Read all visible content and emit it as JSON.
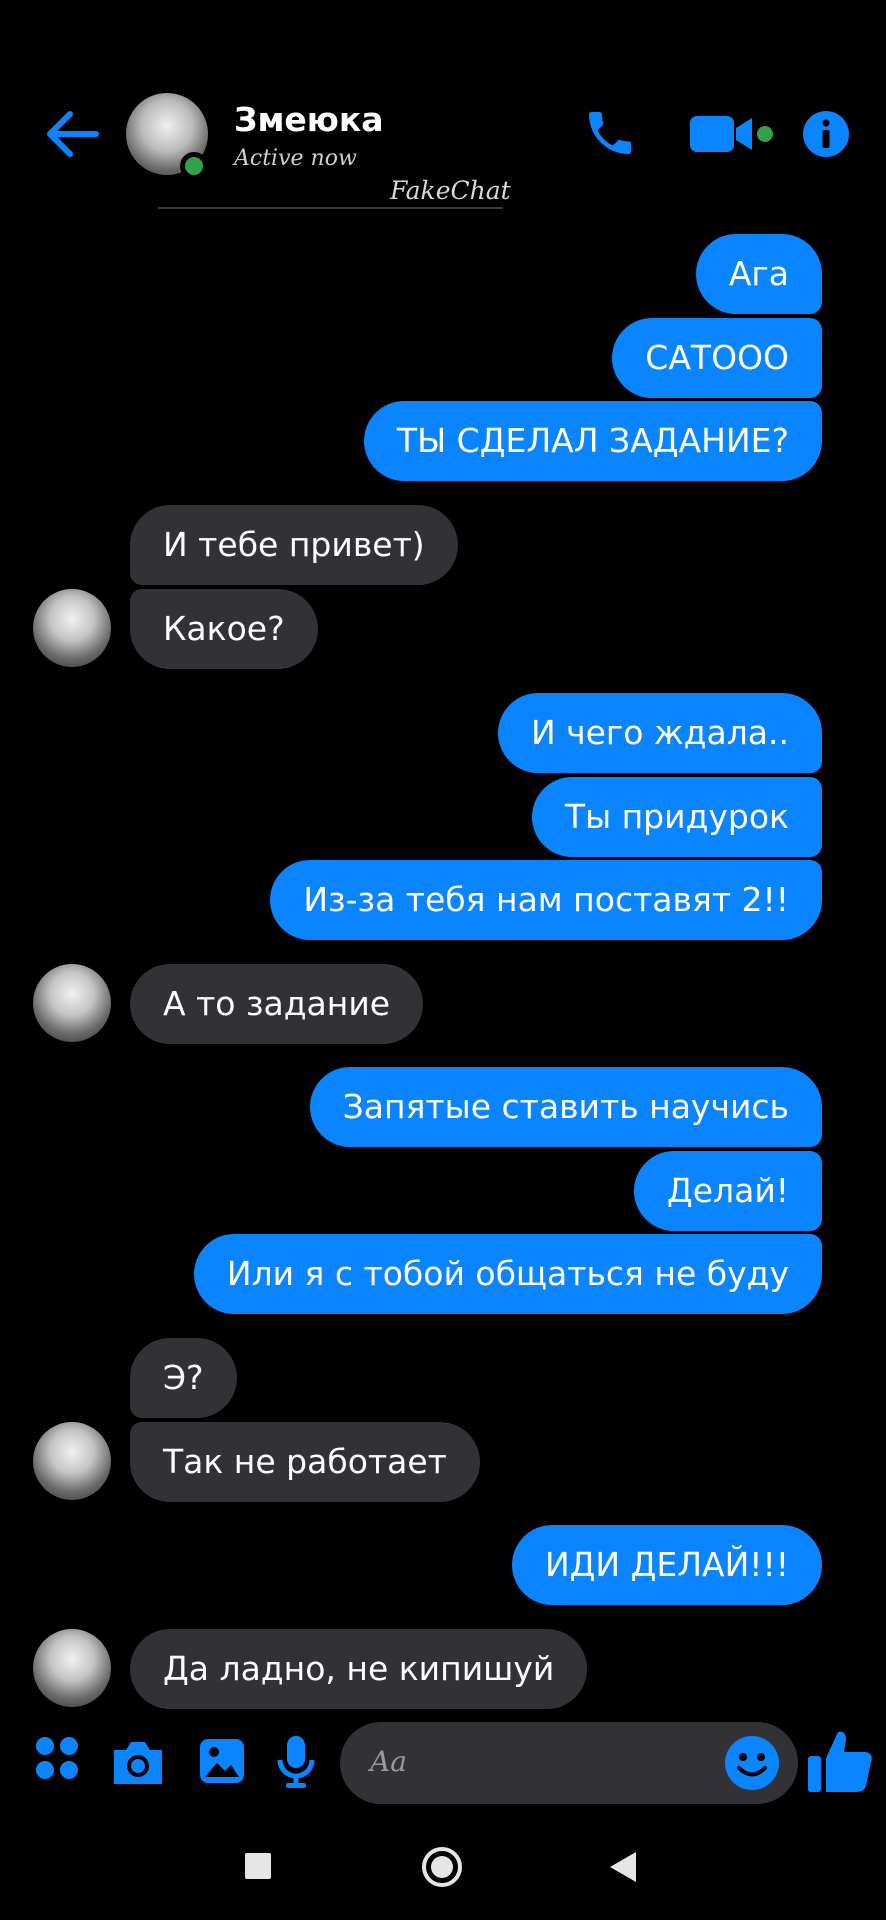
{
  "header": {
    "contact_name": "Змеюка",
    "status": "Active now",
    "watermark": "FakeChat"
  },
  "icons": {
    "back": "back-arrow-icon",
    "call": "phone-icon",
    "video": "video-camera-icon",
    "info": "info-icon",
    "apps": "apps-grid-icon",
    "camera": "camera-icon",
    "gallery": "image-icon",
    "mic": "microphone-icon",
    "emoji": "emoji-icon",
    "like": "thumbs-up-icon"
  },
  "colors": {
    "accent": "#0a84ff",
    "incoming_bubble": "#323236",
    "online": "#31a24c"
  },
  "messages": [
    {
      "text": "Ага"
    },
    {
      "text": "САТООО"
    },
    {
      "text": "ТЫ СДЕЛАЛ ЗАДАНИЕ?"
    },
    {
      "text": "И тебе привет)"
    },
    {
      "text": "Какое?"
    },
    {
      "text": "И чего  ждала.."
    },
    {
      "text": "Ты придурок"
    },
    {
      "text": "Из-за тебя нам поставят 2!!"
    },
    {
      "text": "А то задание"
    },
    {
      "text": "Запятые ставить научись"
    },
    {
      "text": "Делай!"
    },
    {
      "text": "Или я с тобой общаться не буду"
    },
    {
      "text": "Э?"
    },
    {
      "text": "Так не работает"
    },
    {
      "text": "ИДИ ДЕЛАЙ!!!"
    },
    {
      "text": "Да ладно, не кипишуй"
    }
  ],
  "composer": {
    "placeholder": "Aa"
  }
}
